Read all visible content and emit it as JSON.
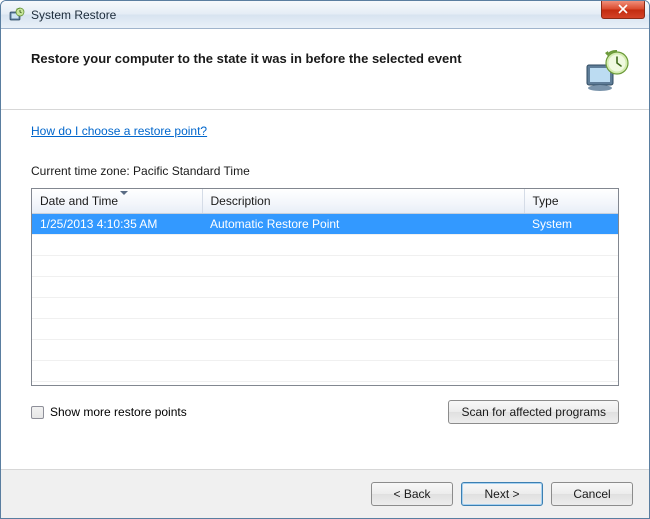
{
  "titlebar": {
    "title": "System Restore"
  },
  "header": {
    "heading": "Restore your computer to the state it was in before the selected event"
  },
  "help_link": "How do I choose a restore point?",
  "timezone_label": "Current time zone: Pacific Standard Time",
  "table": {
    "columns": {
      "date": "Date and Time",
      "desc": "Description",
      "type": "Type"
    },
    "rows": [
      {
        "date": "1/25/2013 4:10:35 AM",
        "desc": "Automatic Restore Point",
        "type": "System"
      }
    ]
  },
  "show_more": {
    "label": "Show more restore points",
    "checked": false
  },
  "scan_button": "Scan for affected programs",
  "footer": {
    "back": "< Back",
    "next": "Next >",
    "cancel": "Cancel"
  }
}
